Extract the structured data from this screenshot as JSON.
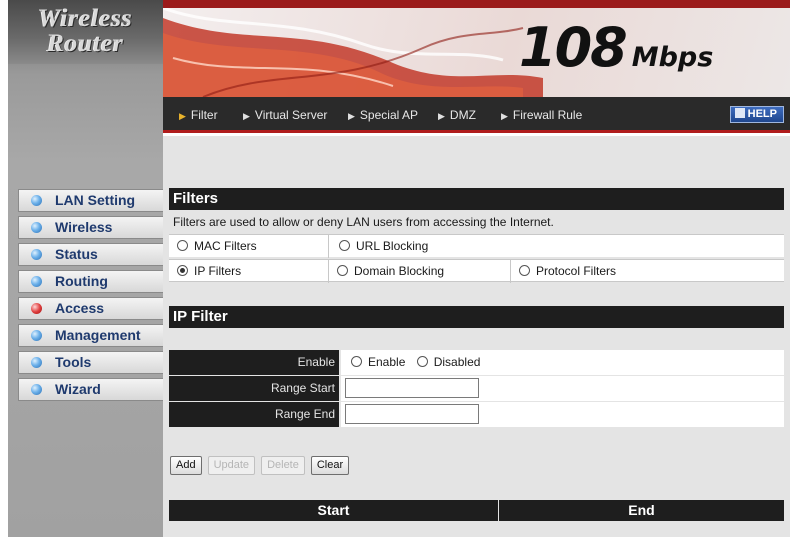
{
  "logo": {
    "line1": "Wireless",
    "line2": "Router"
  },
  "banner": {
    "speed_number": "108",
    "speed_unit": "Mbps"
  },
  "topnav": {
    "tabs": [
      "Filter",
      "Virtual Server",
      "Special AP",
      "DMZ",
      "Firewall Rule"
    ],
    "help_label": "HELP"
  },
  "sidebar": {
    "items": [
      {
        "label": "LAN Setting",
        "icon": "bullet-icon"
      },
      {
        "label": "Wireless",
        "icon": "bullet-icon"
      },
      {
        "label": "Status",
        "icon": "bullet-icon"
      },
      {
        "label": "Routing",
        "icon": "bullet-icon"
      },
      {
        "label": "Access",
        "icon": "bullet-active-icon",
        "active": true
      },
      {
        "label": "Management",
        "icon": "bullet-icon"
      },
      {
        "label": "Tools",
        "icon": "bullet-icon"
      },
      {
        "label": "Wizard",
        "icon": "bullet-icon"
      }
    ]
  },
  "filters": {
    "title": "Filters",
    "description": "Filters are used to allow or deny LAN users from accessing the Internet.",
    "options": [
      {
        "label": "MAC Filters",
        "checked": false
      },
      {
        "label": "URL Blocking",
        "checked": false
      },
      {
        "label": "IP Filters",
        "checked": true
      },
      {
        "label": "Domain Blocking",
        "checked": false
      },
      {
        "label": "Protocol Filters",
        "checked": false
      }
    ]
  },
  "ip_filter": {
    "title": "IP Filter",
    "enable_label": "Enable",
    "enable_option": "Enable",
    "disable_option": "Disabled",
    "range_start_label": "Range Start",
    "range_start_value": "",
    "range_end_label": "Range End",
    "range_end_value": ""
  },
  "buttons": {
    "add": "Add",
    "update": "Update",
    "delete": "Delete",
    "clear": "Clear"
  },
  "table": {
    "columns": [
      "Start",
      "End"
    ]
  },
  "colors": {
    "accent_red": "#b01c1c",
    "dark_bar": "#1e1e1e",
    "menu_text": "#1f3a6e"
  }
}
